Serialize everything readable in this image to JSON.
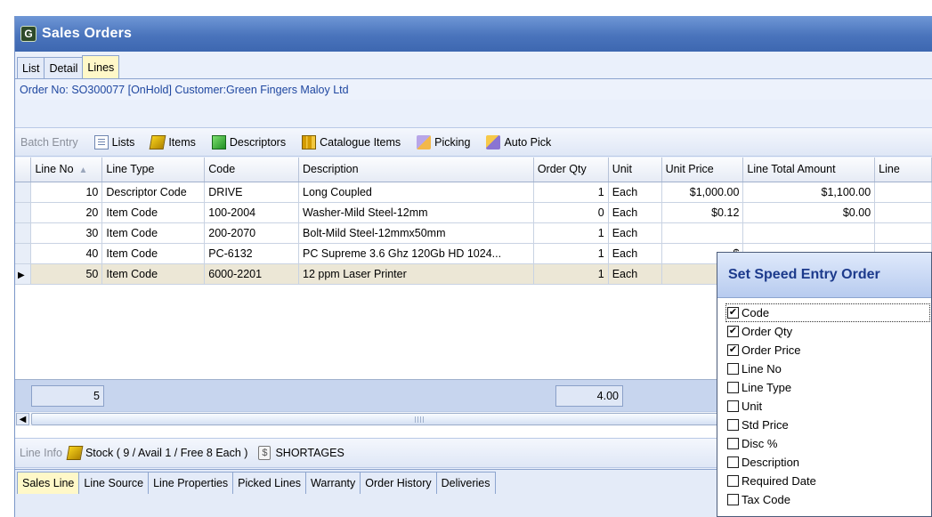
{
  "window": {
    "title": "Sales Orders",
    "icon_glyph": "G"
  },
  "tabs": [
    {
      "label": "List",
      "active": false
    },
    {
      "label": "Detail",
      "active": false
    },
    {
      "label": "Lines",
      "active": true
    }
  ],
  "order_line": "Order No: SO300077 [OnHold] Customer:Green Fingers Maloy Ltd",
  "toolbar": {
    "batch_entry": "Batch Entry",
    "lists": "Lists",
    "items": "Items",
    "descriptors": "Descriptors",
    "catalogue_items": "Catalogue Items",
    "picking": "Picking",
    "auto_pick": "Auto Pick"
  },
  "grid": {
    "columns": [
      "Line No",
      "Line Type",
      "Code",
      "Description",
      "Order Qty",
      "Unit",
      "Unit Price",
      "Line Total Amount",
      "Line"
    ],
    "rows": [
      {
        "line_no": "10",
        "line_type": "Descriptor Code",
        "code": "DRIVE",
        "description": "Long Coupled",
        "order_qty": "1",
        "unit": "Each",
        "unit_price": "$1,000.00",
        "line_total": "$1,100.00"
      },
      {
        "line_no": "20",
        "line_type": "Item Code",
        "code": "100-2004",
        "description": "Washer-Mild Steel-12mm",
        "order_qty": "0",
        "unit": "Each",
        "unit_price": "$0.12",
        "line_total": "$0.00"
      },
      {
        "line_no": "30",
        "line_type": "Item Code",
        "code": "200-2070",
        "description": "Bolt-Mild Steel-12mmx50mm",
        "order_qty": "1",
        "unit": "Each",
        "unit_price": "",
        "line_total": ""
      },
      {
        "line_no": "40",
        "line_type": "Item Code",
        "code": "PC-6132",
        "description": "PC Supreme 3.6 Ghz 120Gb HD 1024...",
        "order_qty": "1",
        "unit": "Each",
        "unit_price": "$",
        "line_total": ""
      },
      {
        "line_no": "50",
        "line_type": "Item Code",
        "code": "6000-2201",
        "description": "12 ppm Laser Printer",
        "order_qty": "1",
        "unit": "Each",
        "unit_price": "",
        "line_total": ""
      }
    ],
    "summary": {
      "count": "5",
      "qty_total": "4.00"
    }
  },
  "line_info": {
    "label": "Line Info",
    "stock": "Stock ( 9 / Avail 1 / Free 8 Each )",
    "shortages": "SHORTAGES"
  },
  "bottom_tabs": [
    {
      "label": "Sales Line",
      "active": true
    },
    {
      "label": "Line Source",
      "active": false
    },
    {
      "label": "Line Properties",
      "active": false
    },
    {
      "label": "Picked Lines",
      "active": false
    },
    {
      "label": "Warranty",
      "active": false
    },
    {
      "label": "Order History",
      "active": false
    },
    {
      "label": "Deliveries",
      "active": false
    }
  ],
  "speed_entry": {
    "title": "Set Speed Entry Order",
    "options": [
      {
        "label": "Code",
        "checked": true
      },
      {
        "label": "Order Qty",
        "checked": true
      },
      {
        "label": "Order Price",
        "checked": true
      },
      {
        "label": "Line No",
        "checked": false
      },
      {
        "label": "Line Type",
        "checked": false
      },
      {
        "label": "Unit",
        "checked": false
      },
      {
        "label": "Std Price",
        "checked": false
      },
      {
        "label": "Disc %",
        "checked": false
      },
      {
        "label": "Description",
        "checked": false
      },
      {
        "label": "Required Date",
        "checked": false
      },
      {
        "label": "Tax Code",
        "checked": false
      }
    ]
  },
  "colors": {
    "title_bar": "#4a74bc",
    "active_tab": "#fff8c8",
    "order_text": "#1f47a0",
    "selected_row": "#ece7d6"
  }
}
